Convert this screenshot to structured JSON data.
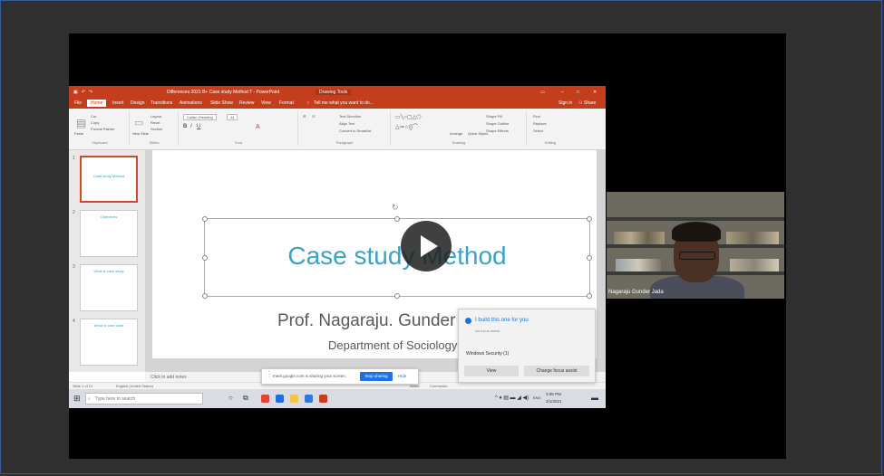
{
  "ppt": {
    "window_title": "Differences 2021 B+ Case study Method T - PowerPoint",
    "drawing_tools": "Drawing Tools",
    "menu": [
      "File",
      "Home",
      "Insert",
      "Design",
      "Transitions",
      "Animations",
      "Slide Show",
      "Review",
      "View",
      "Format"
    ],
    "tell_me": "Tell me what you want to do...",
    "signin": "Sign in",
    "share": "Share",
    "ribbon_groups": [
      "Clipboard",
      "Slides",
      "Font",
      "Paragraph",
      "Drawing",
      "Editing"
    ],
    "ribbon_items": {
      "cut": "Cut",
      "copy": "Copy",
      "format_painter": "Format Painter",
      "paste": "Paste",
      "new_slide": "New Slide",
      "layout": "Layout",
      "reset": "Reset",
      "section": "Section",
      "font_name": "Calibri (Heading",
      "font_size": "44",
      "text_direction": "Text Direction",
      "align_text": "Align Text",
      "smartart": "Convert to SmartArt",
      "arrange": "Arrange",
      "quick_styles": "Quick Styles",
      "shape_fill": "Shape Fill",
      "shape_outline": "Shape Outline",
      "shape_effects": "Shape Effects",
      "find": "Find",
      "replace": "Replace",
      "select": "Select"
    },
    "thumbnails": [
      {
        "num": "1",
        "text": "Case study Method"
      },
      {
        "num": "2",
        "text": "Objectives"
      },
      {
        "num": "3",
        "text": "What is case study"
      },
      {
        "num": "4",
        "text": "What is case case"
      }
    ],
    "slide": {
      "title": "Case study Method",
      "subtitle": "Prof. Nagaraju. Gunder",
      "department": "Department of Sociology"
    },
    "notes_placeholder": "Click to add notes",
    "status_left": "Slide 1 of 21",
    "status_lang": "English (United States)",
    "status_notes": "Notes",
    "status_comments": "Comments"
  },
  "sharebar": {
    "text": "meet.google.com is sharing your screen.",
    "stop": "Stop sharing",
    "hide": "Hide"
  },
  "toast": {
    "title": "I build this one for you",
    "sub": "via focus assist",
    "source": "Windows Security (1)",
    "view": "View",
    "change": "Change focus assist"
  },
  "taskbar": {
    "search_placeholder": "Type here to search",
    "time": "3:56 PM",
    "date": "2/1/2021",
    "lang": "ENG"
  },
  "video": {
    "participant_name": "Nagaraju Gunder Jada"
  }
}
